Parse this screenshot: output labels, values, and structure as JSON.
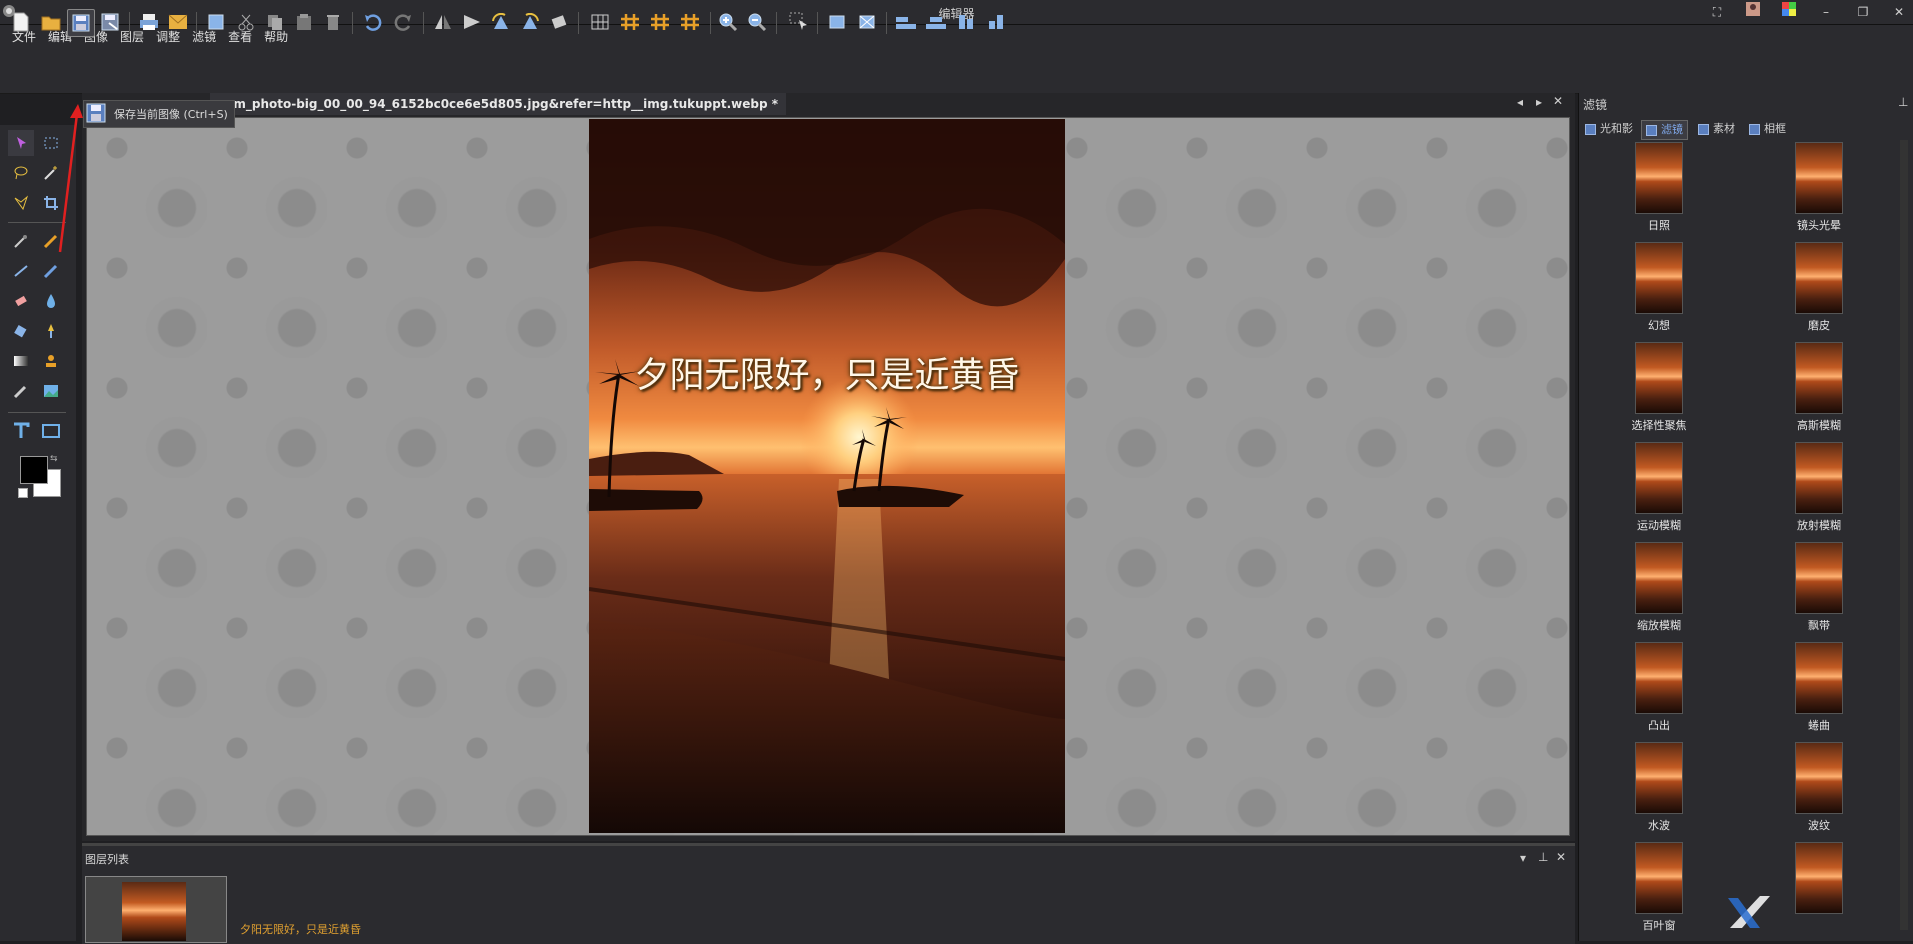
{
  "window": {
    "title": "编辑器"
  },
  "menu": [
    "文件",
    "编辑",
    "图像",
    "图层",
    "调整",
    "滤镜",
    "查看",
    "帮助"
  ],
  "tooltip": {
    "text": "保存当前图像 (Ctrl+S)"
  },
  "document": {
    "tab_title": "com_photo-big_00_00_94_6152bc0ce6e5d805.jpg&refer=http__img.tukuppt.webp *",
    "overlay_text": "夕阳无限好，只是近黄昏"
  },
  "right_panel": {
    "title": "滤镜",
    "tabs": [
      {
        "label": "光和影",
        "active": false
      },
      {
        "label": "滤镜",
        "active": true
      },
      {
        "label": "素材",
        "active": false
      },
      {
        "label": "相框",
        "active": false
      }
    ],
    "filters": [
      "日照",
      "镜头光晕",
      "幻想",
      "磨皮",
      "选择性聚焦",
      "高斯模糊",
      "运动模糊",
      "放射模糊",
      "缩放模糊",
      "飘带",
      "凸出",
      "蜷曲",
      "水波",
      "波纹",
      "百叶窗",
      ""
    ]
  },
  "layer_panel": {
    "title": "图层列表",
    "layers": [
      {
        "name": "夕阳无限好，只是近黄昏"
      }
    ]
  },
  "colors": {
    "accent_orange": "#e8a028",
    "annotation_red": "#e02020",
    "foreground": "#000000",
    "background": "#ffffff"
  }
}
